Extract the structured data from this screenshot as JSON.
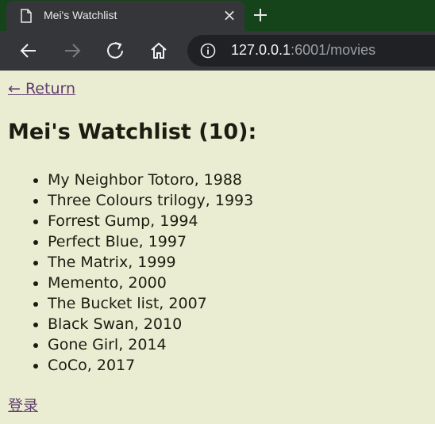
{
  "browser": {
    "tab_title": "Mei's Watchlist",
    "url_host": "127.0.0.1",
    "url_rest": ":6001/movies"
  },
  "page": {
    "return_label": "← Return",
    "heading": "Mei's Watchlist (10):",
    "movies": [
      "My Neighbor Totoro, 1988",
      "Three Colours trilogy, 1993",
      "Forrest Gump, 1994",
      "Perfect Blue, 1997",
      "The Matrix, 1999",
      "Memento, 2000",
      "The Bucket list, 2007",
      "Black Swan, 2010",
      "Gone Girl, 2014",
      "CoCo, 2017"
    ],
    "login_label": "登录"
  },
  "theme": {
    "page_background": "#ebedd3",
    "tabstrip_background": "#16441a",
    "link_color": "#5f3d6d"
  }
}
